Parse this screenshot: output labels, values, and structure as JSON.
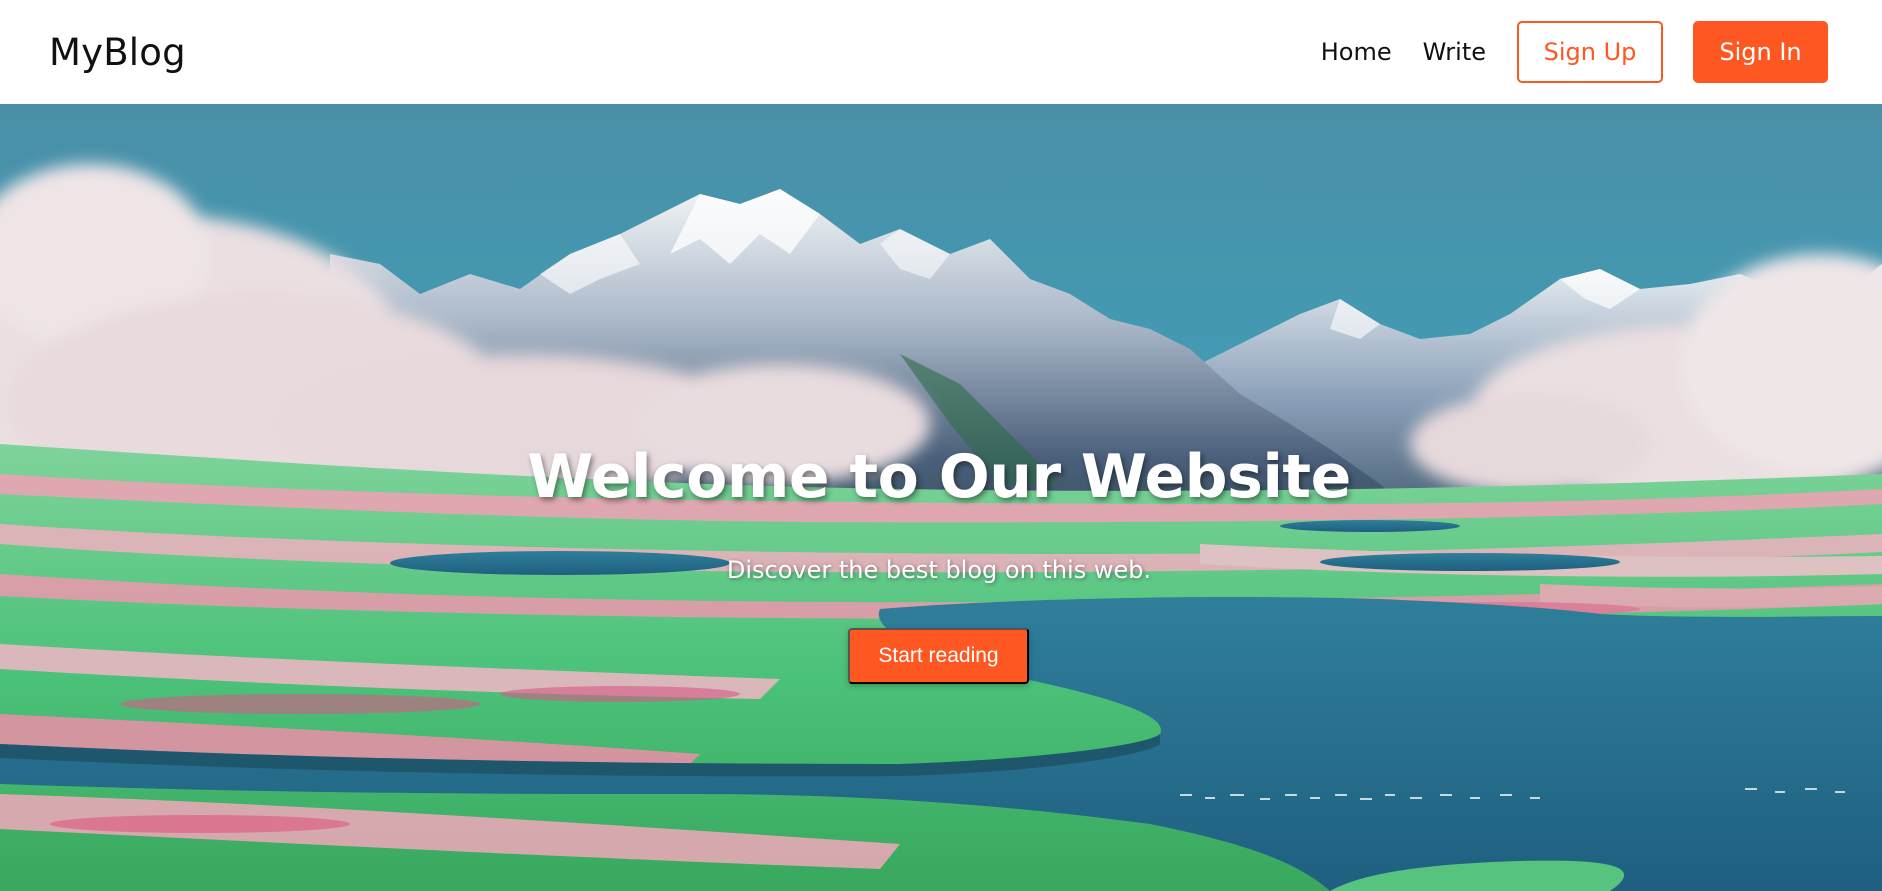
{
  "navbar": {
    "brand": "MyBlog",
    "links": [
      "Home",
      "Write"
    ],
    "signup_label": "Sign Up",
    "signin_label": "Sign In"
  },
  "hero": {
    "title": "Welcome to Our Website",
    "subtitle": "Discover the best blog on this web.",
    "cta_label": "Start reading"
  },
  "colors": {
    "accent": "#ff5722",
    "sky": "#3f97ad",
    "text": "#111111"
  }
}
